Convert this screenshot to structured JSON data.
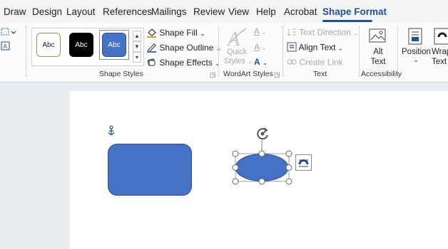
{
  "tabs": [
    "Draw",
    "Design",
    "Layout",
    "References",
    "Mailings",
    "Review",
    "View",
    "Help",
    "Acrobat",
    "Shape Format"
  ],
  "active_tab": "Shape Format",
  "shape_styles": {
    "swatches": [
      "Abc",
      "Abc",
      "Abc"
    ],
    "fill_label": "Shape Fill",
    "outline_label": "Shape Outline",
    "effects_label": "Shape Effects",
    "group_label": "Shape Styles"
  },
  "wordart": {
    "quick_styles_line1": "Quick",
    "quick_styles_line2": "Styles",
    "group_label": "WordArt Styles"
  },
  "text_group": {
    "text_direction_label": "Text Direction",
    "align_text_label": "Align Text",
    "create_link_label": "Create Link",
    "group_label": "Text"
  },
  "accessibility": {
    "alt_text_line1": "Alt",
    "alt_text_line2": "Text",
    "group_label": "Accessibility"
  },
  "arrange": {
    "position_label": "Position",
    "wrap_line1": "Wrap",
    "wrap_line2": "Text"
  },
  "colors": {
    "accent": "#1f4e9b",
    "shape_fill": "#4472c4",
    "shape_border": "#2f4f8f"
  },
  "icons": [
    "anchor-icon",
    "rotate-handle-icon",
    "layout-options-icon",
    "paint-bucket-icon",
    "pen-icon",
    "effects-icon"
  ]
}
